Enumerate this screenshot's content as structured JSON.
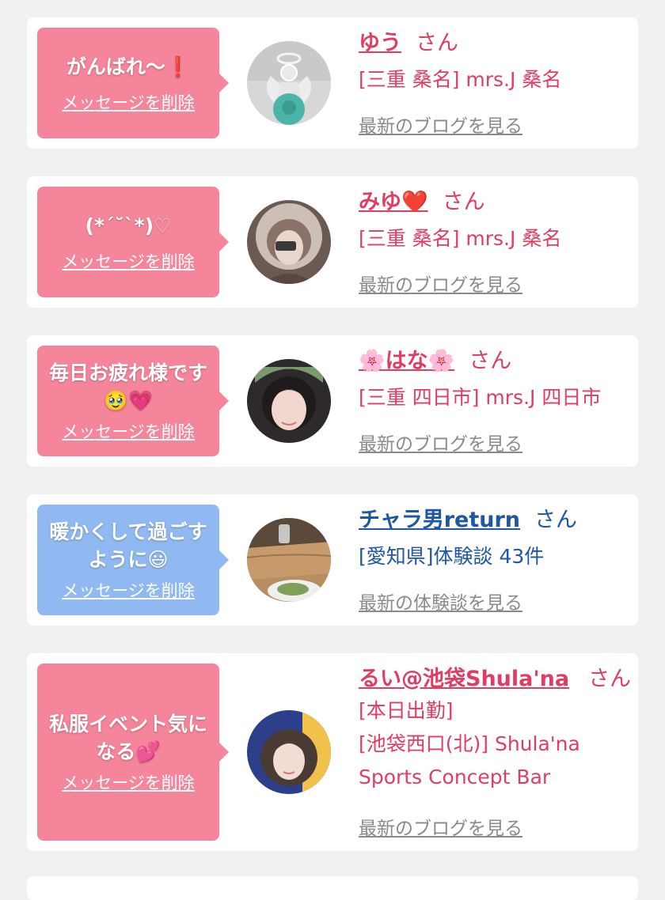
{
  "cards": [
    {
      "message": "がんばれ〜",
      "emoji": "❗",
      "delete_label": "メッセージを削除",
      "name": "ゆう",
      "name_emoji": "",
      "san": "さん",
      "details": [
        "[三重 桑名] mrs.J 桑名"
      ],
      "link": "最新のブログを見る",
      "bubble_color": "#f4859a",
      "text_color": "#e03d63",
      "avatar": "angel-figurine-photo"
    },
    {
      "message": "(*´˘`*)",
      "emoji": "♡",
      "delete_label": "メッセージを削除",
      "name": "みゆ",
      "name_emoji": "❤️",
      "san": "さん",
      "details": [
        "[三重 桑名] mrs.J 桑名"
      ],
      "link": "最新のブログを見る",
      "bubble_color": "#f4859a",
      "text_color": "#e03d63",
      "avatar": "fur-hood-girl-photo"
    },
    {
      "message": "毎日お疲れ様です",
      "emoji": "🥹💗",
      "delete_label": "メッセージを削除",
      "name": "はな",
      "name_prefix": "🌸",
      "name_emoji": "🌸",
      "san": "さん",
      "details": [
        "[三重 四日市] mrs.J 四日市"
      ],
      "link": "最新のブログを見る",
      "bubble_color": "#f4859a",
      "text_color": "#e03d63",
      "avatar": "woman-selfie-photo"
    },
    {
      "message": "暖かくして過ごすように",
      "emoji": "😃",
      "delete_label": "メッセージを削除",
      "name": "チャラ男return",
      "name_emoji": "",
      "san": "さん",
      "details": [
        "[愛知県]体験談 43件"
      ],
      "link": "最新の体験談を見る",
      "bubble_color": "#8fb9f0",
      "text_color": "#1f56a6",
      "avatar": "dining-table-photo"
    },
    {
      "message": "私服イベント気になる",
      "emoji": "💕",
      "delete_label": "メッセージを削除",
      "name": "るい@池袋Shula'na",
      "name_emoji": "",
      "san": "さん",
      "details": [
        "[本日出勤]",
        "[池袋西口(北)] Shula'na",
        "Sports Concept Bar"
      ],
      "link": "最新のブログを見る",
      "bubble_color": "#f4859a",
      "text_color": "#e03d63",
      "avatar": "woman-portrait-photo"
    }
  ]
}
